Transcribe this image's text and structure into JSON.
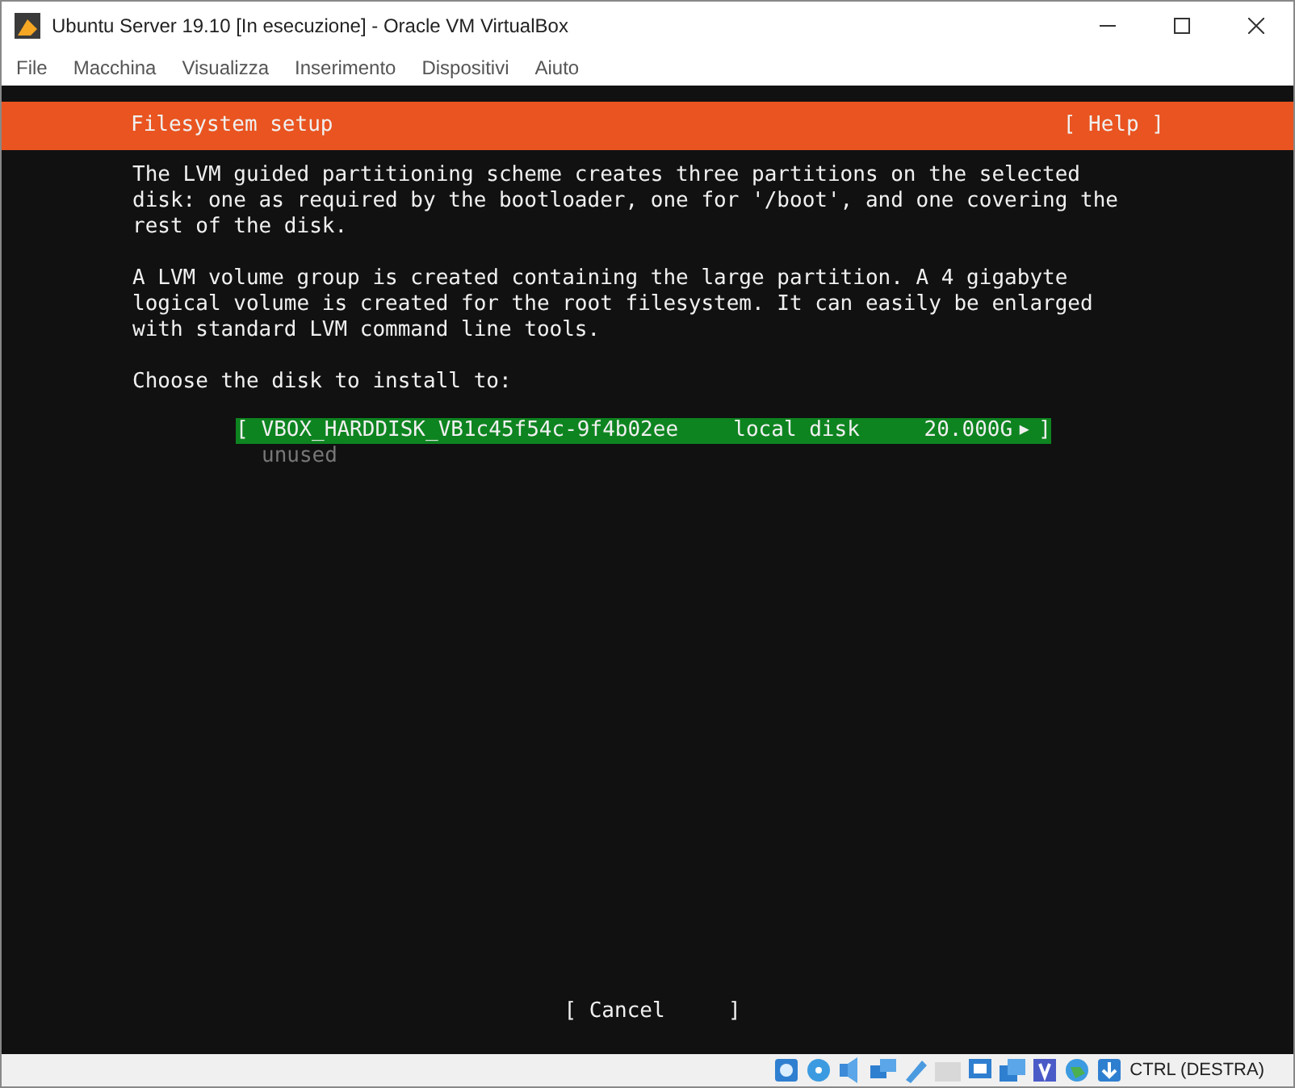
{
  "window": {
    "title": "Ubuntu Server 19.10 [In esecuzione] - Oracle VM VirtualBox"
  },
  "menu": [
    "File",
    "Macchina",
    "Visualizza",
    "Inserimento",
    "Dispositivi",
    "Aiuto"
  ],
  "installer": {
    "header": "Filesystem setup",
    "help": "[ Help ]",
    "paragraphs": [
      "The LVM guided partitioning scheme creates three partitions on the selected\ndisk: one as required by the bootloader, one for '/boot', and one covering the\nrest of the disk.",
      "A LVM volume group is created containing the large partition. A 4 gigabyte\nlogical volume is created for the root filesystem. It can easily be enlarged\nwith standard LVM command line tools."
    ],
    "prompt": "Choose the disk to install to:",
    "disks": [
      {
        "open": "[",
        "name": "VBOX_HARDDISK_VB1c45f54c-9f4b02ee",
        "type": "local disk",
        "size": "20.000G",
        "arrow": "▶",
        "close": "]",
        "selected": true,
        "note": "unused"
      }
    ],
    "cancel": "[ Cancel     ]"
  },
  "status_bar": {
    "host_key": "CTRL (DESTRA)"
  }
}
